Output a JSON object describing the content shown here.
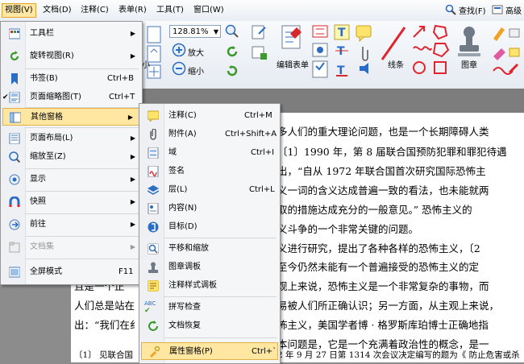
{
  "menubar": {
    "items": [
      {
        "label": "视图(V)"
      },
      {
        "label": "文档(D)"
      },
      {
        "label": "注释(C)"
      },
      {
        "label": "表单(R)"
      },
      {
        "label": "工具(T)"
      },
      {
        "label": "窗口(W)"
      }
    ],
    "search_label": "查找(F)",
    "advanced_label": "高级"
  },
  "ribbon": {
    "zoom_value": "128.81%",
    "zoom_in_label": "放大",
    "zoom_out_label": "缩小",
    "edit_form_label": "编辑表单",
    "line_label": "线条",
    "stamp_label": "图章",
    "partial_label": "小"
  },
  "view_menu": {
    "items": [
      {
        "label": "工具栏",
        "shortcut": "",
        "submenu": true
      },
      {
        "label": "旋转视图(R)",
        "shortcut": "",
        "submenu": true
      },
      {
        "label": "书签(B)",
        "shortcut": "Ctrl+B"
      },
      {
        "label": "页面缩略图(T)",
        "shortcut": "Ctrl+T",
        "checked": true
      },
      {
        "label": "其他窗格",
        "shortcut": "",
        "submenu": true,
        "highlighted": true
      },
      {
        "label": "页面布局(L)",
        "shortcut": "",
        "submenu": true
      },
      {
        "label": "缩放至(Z)",
        "shortcut": "",
        "submenu": true
      },
      {
        "label": "显示",
        "shortcut": "",
        "submenu": true
      },
      {
        "label": "快照",
        "shortcut": "",
        "submenu": true
      },
      {
        "label": "前往",
        "shortcut": "",
        "submenu": true
      },
      {
        "label": "文档集",
        "shortcut": "",
        "submenu": true,
        "disabled": true
      },
      {
        "label": "全屏模式",
        "shortcut": "F11"
      }
    ]
  },
  "panes_menu": {
    "items": [
      {
        "label": "注释(C)",
        "shortcut": "Ctrl+M"
      },
      {
        "label": "附件(A)",
        "shortcut": "Ctrl+Shift+A"
      },
      {
        "label": "域",
        "shortcut": "Ctrl+I"
      },
      {
        "label": "签名",
        "shortcut": ""
      },
      {
        "label": "层(L)",
        "shortcut": "Ctrl+L"
      },
      {
        "label": "内容(N)",
        "shortcut": ""
      },
      {
        "label": "目标(D)",
        "shortcut": ""
      },
      {
        "label": "平移和缩放",
        "shortcut": ""
      },
      {
        "label": "图章调板",
        "shortcut": ""
      },
      {
        "label": "注释样式调板",
        "shortcut": ""
      },
      {
        "label": "拼写检查",
        "shortcut": ""
      },
      {
        "label": "文档恢复",
        "shortcut": ""
      },
      {
        "label": "属性窗格(P)",
        "shortcut": "Ctrl+`",
        "highlighted": true
      }
    ],
    "icon_text_abc": "ABC"
  },
  "document": {
    "lines": [
      "多人们的重大理论问题，也是一个长期障碍人类",
      "〔1〕1990 年，第 8 届联合国预防犯罪和罪犯待遇",
      "出，“自从 1972 年联合国首次研究国际恐怖主",
      "义一词的含义达成普遍一致的看法，也未能就两",
      "取的措施达成充分的一般意见。” 恐怖主义的",
      "义斗争的一个非常关键的问题。",
      "义进行研究，提出了各种各样的恐怖主义，〔2",
      "至今仍然未能有一个普遍接受的恐怖主义的定",
      "观上来说，恐怖主义是一个非常复杂的事物，而",
      "易被人们所正确认识；另一方面，从主观上来说，",
      "人们总是站在",
      "怖主义，美国学者博 · 格罗斯库珀博士正确地指",
      "出：“我们在纟",
      "本问题是，它是一个充满着政治性的概念，是一",
      "〔1〕 见联合国",
      "2 年 9 月 27 日第 1314 次会议决定编写的题为《 防止危害或杀"
    ],
    "left_frag_1": "且是一个正",
    "left_frag_2": "人们总是站在"
  },
  "colors": {
    "highlight": "#ffe7a2",
    "menu_bg": "#f5f6f7",
    "accent_red": "#e0252e",
    "accent_blue": "#2b6cc4"
  }
}
